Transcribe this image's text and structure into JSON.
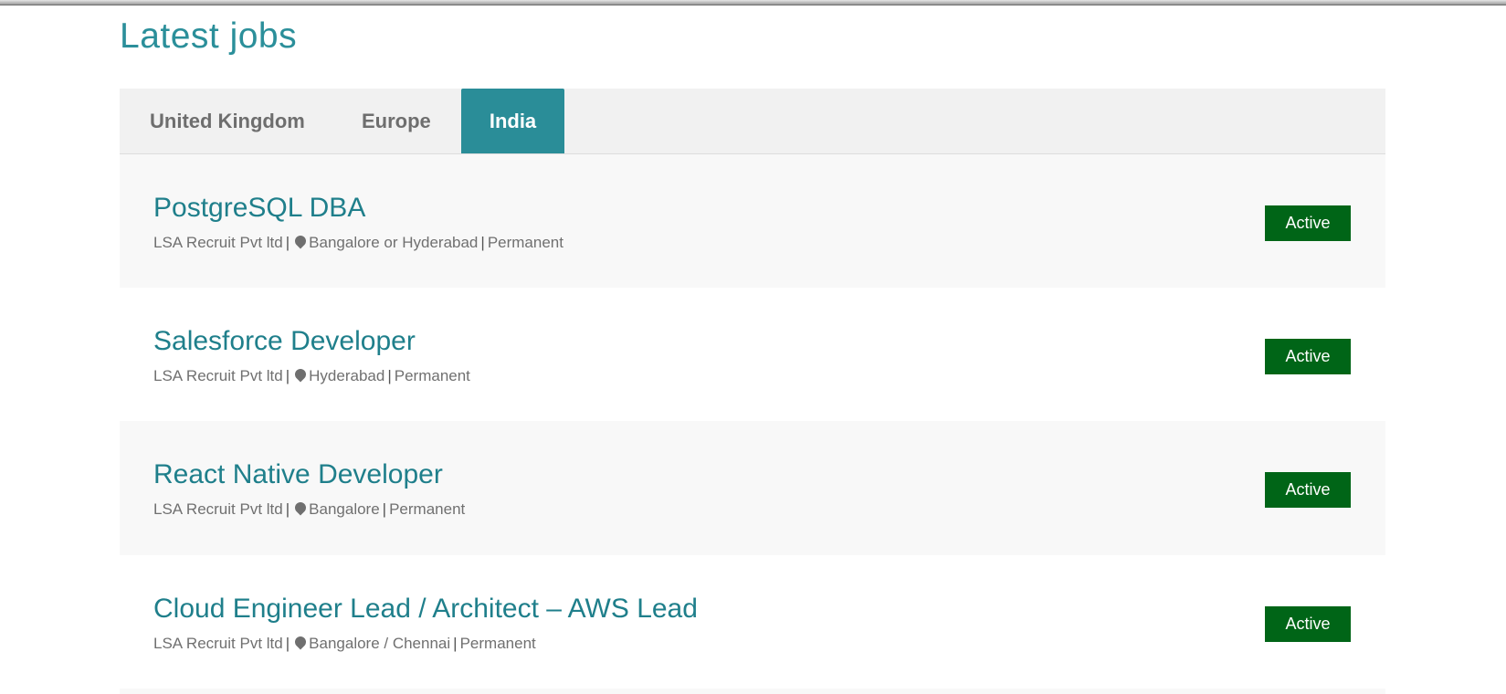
{
  "page": {
    "title": "Latest jobs"
  },
  "tabs": [
    {
      "label": "United Kingdom",
      "active": false
    },
    {
      "label": "Europe",
      "active": false
    },
    {
      "label": "India",
      "active": true
    }
  ],
  "jobs": [
    {
      "title": "PostgreSQL DBA",
      "company": "LSA Recruit Pvt ltd",
      "location": "Bangalore or Hyderabad",
      "type": "Permanent",
      "status": "Active"
    },
    {
      "title": "Salesforce Developer",
      "company": "LSA Recruit Pvt ltd",
      "location": "Hyderabad",
      "type": "Permanent",
      "status": "Active"
    },
    {
      "title": "React Native Developer",
      "company": "LSA Recruit Pvt ltd",
      "location": "Bangalore",
      "type": "Permanent",
      "status": "Active"
    },
    {
      "title": "Cloud Engineer Lead / Architect – AWS Lead",
      "company": "LSA Recruit Pvt ltd",
      "location": "Bangalore / Chennai",
      "type": "Permanent",
      "status": "Active"
    }
  ],
  "icons": {
    "location": "map-pin-icon"
  },
  "colors": {
    "accent": "#2a8d98",
    "title_link": "#1f7f8b",
    "status_active": "#006517"
  }
}
